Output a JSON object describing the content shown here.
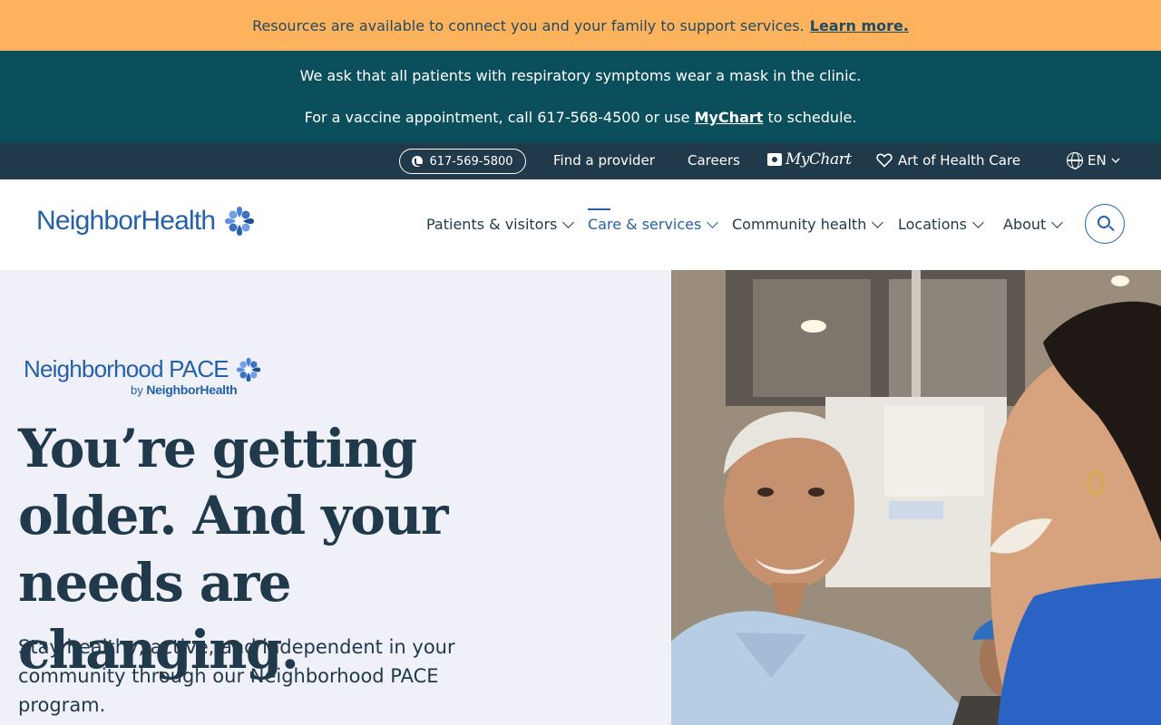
{
  "promo": {
    "text": "Resources are available to connect you and your family to support services.",
    "link": "Learn more."
  },
  "alert": {
    "line1": "We ask that all patients with respiratory symptoms wear a mask in the clinic.",
    "line2_before": "For a vaccine appointment, call 617-568-4500 or use",
    "line2_link": "MyChart",
    "line2_after": "to schedule."
  },
  "utility": {
    "phone": "617-569-5800",
    "find_provider": "Find a provider",
    "careers": "Careers",
    "mychart": "MyChart",
    "art_of_health_care": "Art of Health Care",
    "language": "EN"
  },
  "nav": {
    "logo": "NeighborHealth",
    "items": [
      {
        "label": "Patients & visitors"
      },
      {
        "label": "Care & services"
      },
      {
        "label": "Community health"
      },
      {
        "label": "Locations"
      },
      {
        "label": "About"
      }
    ]
  },
  "hero": {
    "program_logo_title": "Neighborhood PACE",
    "program_logo_by": "by",
    "program_logo_org": "NeighborHealth",
    "title": "You’re getting older. And your needs are changing.",
    "copy": "Stay healthy, active, and independent in your community through our Neighborhood PACE program."
  },
  "colors": {
    "promo_bg": "#fdb35e",
    "alert_bg": "#0b4f5d",
    "utility_bg": "#213a4b",
    "brand_blue": "#2461a8",
    "hero_bg": "#eff0f8"
  }
}
